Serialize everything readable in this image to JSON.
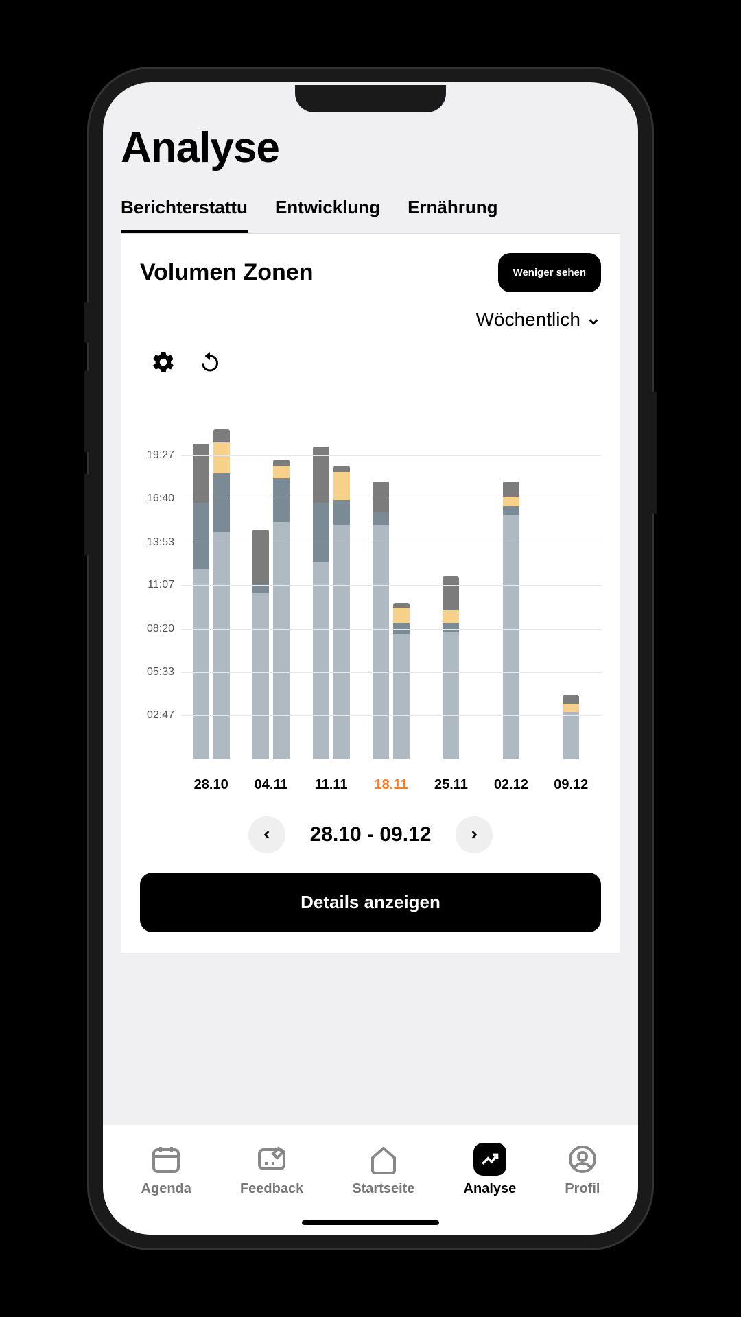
{
  "header": {
    "title": "Analyse"
  },
  "tabs": [
    {
      "label": "Berichterstattu",
      "active": true
    },
    {
      "label": "Entwicklung",
      "active": false
    },
    {
      "label": "Ernährung",
      "active": false
    }
  ],
  "card": {
    "title": "Volumen Zonen",
    "toggle_label": "Weniger sehen",
    "period_label": "Wöchentlich",
    "range_label": "28.10 - 09.12",
    "details_label": "Details anzeigen"
  },
  "chart_data": {
    "type": "bar",
    "ylabel_format": "hh:mm",
    "ylim": [
      0,
      22
    ],
    "y_ticks": [
      "02:47",
      "05:33",
      "08:20",
      "11:07",
      "13:53",
      "16:40",
      "19:27"
    ],
    "y_tick_values": [
      2.78,
      5.55,
      8.33,
      11.12,
      13.88,
      16.67,
      19.45
    ],
    "categories": [
      "28.10",
      "04.11",
      "11.11",
      "18.11",
      "25.11",
      "02.12",
      "09.12"
    ],
    "highlight_category": "18.11",
    "segment_colors": {
      "base": "#aeb9c1",
      "mid": "#7b8b96",
      "accent": "#f7d08a",
      "top": "#7c7c7c"
    },
    "series_note": "Each category has planned (left) and actual (right) stacked bars; values are approximate hours read from axis.",
    "groups": [
      {
        "category": "28.10",
        "bars": [
          {
            "name": "planned",
            "segments": {
              "base": 12.2,
              "mid": 4.2,
              "accent": 0,
              "top": 3.8
            }
          },
          {
            "name": "actual",
            "segments": {
              "base": 14.5,
              "mid": 3.8,
              "accent": 2.0,
              "top": 0.8
            }
          }
        ]
      },
      {
        "category": "04.11",
        "bars": [
          {
            "name": "planned",
            "segments": {
              "base": 10.6,
              "mid": 0.6,
              "accent": 0,
              "top": 3.5
            }
          },
          {
            "name": "actual",
            "segments": {
              "base": 15.2,
              "mid": 2.8,
              "accent": 0.8,
              "top": 0.4
            }
          }
        ]
      },
      {
        "category": "11.11",
        "bars": [
          {
            "name": "planned",
            "segments": {
              "base": 12.6,
              "mid": 3.8,
              "accent": 0,
              "top": 3.6
            }
          },
          {
            "name": "actual",
            "segments": {
              "base": 15.0,
              "mid": 1.6,
              "accent": 1.8,
              "top": 0.4
            }
          }
        ]
      },
      {
        "category": "18.11",
        "bars": [
          {
            "name": "planned",
            "segments": {
              "base": 15.0,
              "mid": 0.8,
              "accent": 0,
              "top": 2.0
            }
          },
          {
            "name": "actual",
            "segments": {
              "base": 8.0,
              "mid": 0.7,
              "accent": 1.0,
              "top": 0.3
            }
          }
        ]
      },
      {
        "category": "25.11",
        "bars": [
          {
            "name": "planned",
            "segments": {
              "base": 8.1,
              "mid": 0.6,
              "accent": 0.8,
              "top": 2.2
            }
          },
          {
            "name": "actual",
            "segments": {
              "base": 0,
              "mid": 0,
              "accent": 0,
              "top": 0
            }
          }
        ]
      },
      {
        "category": "02.12",
        "bars": [
          {
            "name": "planned",
            "segments": {
              "base": 15.6,
              "mid": 0.6,
              "accent": 0.6,
              "top": 1.0
            }
          },
          {
            "name": "actual",
            "segments": {
              "base": 0,
              "mid": 0,
              "accent": 0,
              "top": 0
            }
          }
        ]
      },
      {
        "category": "09.12",
        "bars": [
          {
            "name": "planned",
            "segments": {
              "base": 3.0,
              "mid": 0,
              "accent": 0.5,
              "top": 0.6
            }
          },
          {
            "name": "actual",
            "segments": {
              "base": 0,
              "mid": 0,
              "accent": 0,
              "top": 0
            }
          }
        ]
      }
    ]
  },
  "bottom_nav": [
    {
      "id": "agenda",
      "label": "Agenda",
      "active": false
    },
    {
      "id": "feedback",
      "label": "Feedback",
      "active": false
    },
    {
      "id": "startseite",
      "label": "Startseite",
      "active": false
    },
    {
      "id": "analyse",
      "label": "Analyse",
      "active": true
    },
    {
      "id": "profil",
      "label": "Profil",
      "active": false
    }
  ]
}
